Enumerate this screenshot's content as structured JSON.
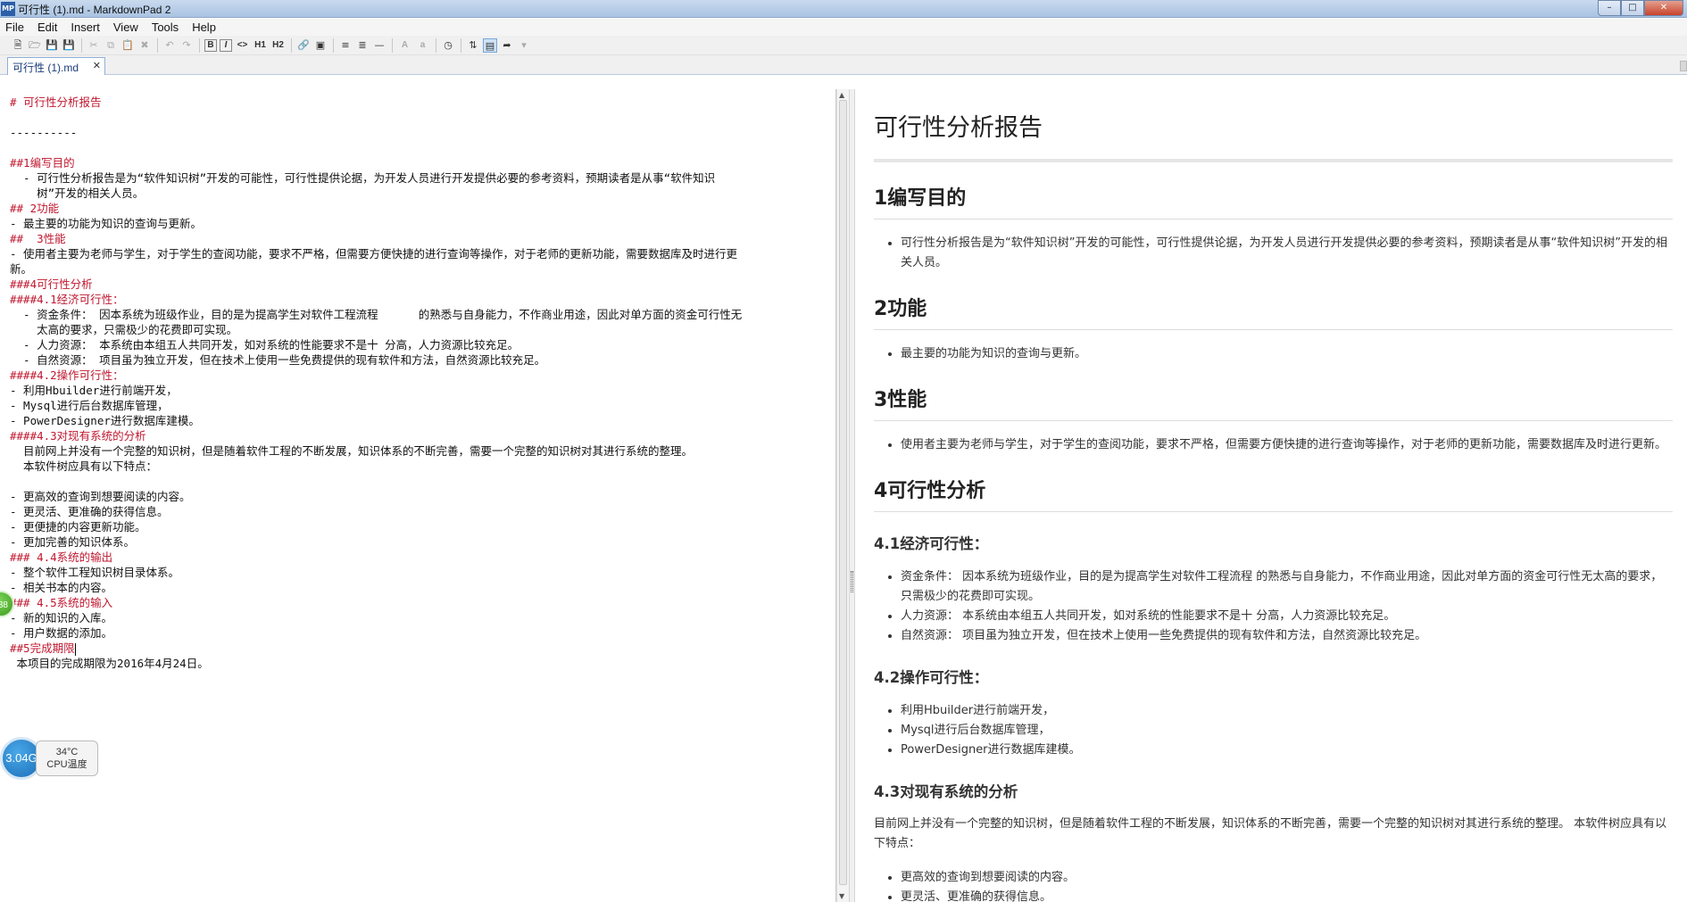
{
  "window": {
    "title": "可行性 (1).md - MarkdownPad 2",
    "app_icon": "MP"
  },
  "menu": [
    "File",
    "Edit",
    "Insert",
    "View",
    "Tools",
    "Help"
  ],
  "tab": {
    "label": "可行性 (1).md",
    "close": "✕"
  },
  "toolbar": {
    "h1_label": "H1",
    "h2_label": "H2",
    "bold_label": "B",
    "italic_label": "I",
    "code_label": "<>",
    "upper_a": "A",
    "lower_a": "a"
  },
  "editor_lines": [
    [
      {
        "t": "# 可行性分析报告",
        "h": true
      }
    ],
    [
      {
        "t": ""
      }
    ],
    [
      {
        "t": "----------"
      }
    ],
    [
      {
        "t": ""
      }
    ],
    [
      {
        "t": "##1编写目的",
        "h": true
      }
    ],
    [
      {
        "t": "  - 可行性分析报告是为“软件知识树”开发的可能性，可行性提供论据，为开发人员进行开发提供必要的参考资料，预期读者是从事“软件知识"
      }
    ],
    [
      {
        "t": "    树”开发的相关人员。"
      }
    ],
    [
      {
        "t": "## 2功能",
        "h": true
      }
    ],
    [
      {
        "t": "- 最主要的功能为知识的查询与更新。"
      }
    ],
    [
      {
        "t": "##  3性能",
        "h": true
      }
    ],
    [
      {
        "t": "- 使用者主要为老师与学生，对于学生的查阅功能，要求不严格，但需要方便快捷的进行查询等操作，对于老师的更新功能，需要数据库及时进行更"
      }
    ],
    [
      {
        "t": "新。"
      }
    ],
    [
      {
        "t": "###4可行性分析",
        "h": true
      }
    ],
    [
      {
        "t": "####4.1经济可行性：",
        "h": true
      }
    ],
    [
      {
        "t": "  - 资金条件： 因本系统为班级作业，目的是为提高学生对软件工程流程      的熟悉与自身能力，不作商业用途，因此对单方面的资金可行性无"
      }
    ],
    [
      {
        "t": "    太高的要求，只需极少的花费即可实现。"
      }
    ],
    [
      {
        "t": "  - 人力资源： 本系统由本组五人共同开发，如对系统的性能要求不是十 分高，人力资源比较充足。"
      }
    ],
    [
      {
        "t": "  - 自然资源： 项目虽为独立开发，但在技术上使用一些免费提供的现有软件和方法，自然资源比较充足。"
      }
    ],
    [
      {
        "t": "####4.2操作可行性：",
        "h": true
      }
    ],
    [
      {
        "t": "- 利用Hbuilder进行前端开发，"
      }
    ],
    [
      {
        "t": "- Mysql进行后台数据库管理，"
      }
    ],
    [
      {
        "t": "- PowerDesigner进行数据库建模。"
      }
    ],
    [
      {
        "t": "####4.3对现有系统的分析",
        "h": true
      }
    ],
    [
      {
        "t": "  目前网上并没有一个完整的知识树，但是随着软件工程的不断发展，知识体系的不断完善，需要一个完整的知识树对其进行系统的整理。"
      }
    ],
    [
      {
        "t": "  本软件树应具有以下特点："
      }
    ],
    [
      {
        "t": ""
      }
    ],
    [
      {
        "t": "- 更高效的查询到想要阅读的内容。"
      }
    ],
    [
      {
        "t": "- 更灵活、更准确的获得信息。"
      }
    ],
    [
      {
        "t": "- 更便捷的内容更新功能。"
      }
    ],
    [
      {
        "t": "- 更加完善的知识体系。"
      }
    ],
    [
      {
        "t": "### 4.4系统的输出",
        "h": true
      }
    ],
    [
      {
        "t": "- 整个软件工程知识树目录体系。"
      }
    ],
    [
      {
        "t": "- 相关书本的内容。"
      }
    ],
    [
      {
        "t": "### 4.5系统的输入",
        "h": true
      }
    ],
    [
      {
        "t": "- 新的知识的入库。"
      }
    ],
    [
      {
        "t": "- 用户数据的添加。"
      }
    ],
    [
      {
        "t": "##5完成期限",
        "h": true,
        "caret": true
      }
    ],
    [
      {
        "t": " 本项目的完成期限为2016年4月24日。"
      }
    ]
  ],
  "preview": {
    "title": "可行性分析报告",
    "sec1": {
      "heading": "1编写目的",
      "items": [
        "可行性分析报告是为“软件知识树”开发的可能性，可行性提供论据，为开发人员进行开发提供必要的参考资料，预期读者是从事“软件知识树”开发的相关人员。"
      ]
    },
    "sec2": {
      "heading": "2功能",
      "items": [
        "最主要的功能为知识的查询与更新。"
      ]
    },
    "sec3": {
      "heading": "3性能",
      "items": [
        "使用者主要为老师与学生，对于学生的查阅功能，要求不严格，但需要方便快捷的进行查询等操作，对于老师的更新功能，需要数据库及时进行更新。"
      ]
    },
    "sec4": {
      "heading": "4可行性分析"
    },
    "sec41": {
      "heading": "4.1经济可行性：",
      "items": [
        "资金条件： 因本系统为班级作业，目的是为提高学生对软件工程流程 的熟悉与自身能力，不作商业用途，因此对单方面的资金可行性无太高的要求，只需极少的花费即可实现。",
        "人力资源： 本系统由本组五人共同开发，如对系统的性能要求不是十 分高，人力资源比较充足。",
        "自然资源： 项目虽为独立开发，但在技术上使用一些免费提供的现有软件和方法，自然资源比较充足。"
      ]
    },
    "sec42": {
      "heading": "4.2操作可行性：",
      "items": [
        "利用Hbuilder进行前端开发，",
        "Mysql进行后台数据库管理，",
        "PowerDesigner进行数据库建模。"
      ]
    },
    "sec43": {
      "heading": "4.3对现有系统的分析",
      "para": "目前网上并没有一个完整的知识树，但是随着软件工程的不断发展，知识体系的不断完善，需要一个完整的知识树对其进行系统的整理。 本软件树应具有以下特点：",
      "items": [
        "更高效的查询到想要阅读的内容。",
        "更灵活、更准确的获得信息。"
      ]
    }
  },
  "overlays": {
    "green_badge": "38",
    "ram_value": "3.04G",
    "cpu_temp": "34°C",
    "cpu_label": "CPU温度"
  },
  "colors": {
    "heading_markdown": "#c0172f",
    "titlebar": "#a9c3e2"
  }
}
